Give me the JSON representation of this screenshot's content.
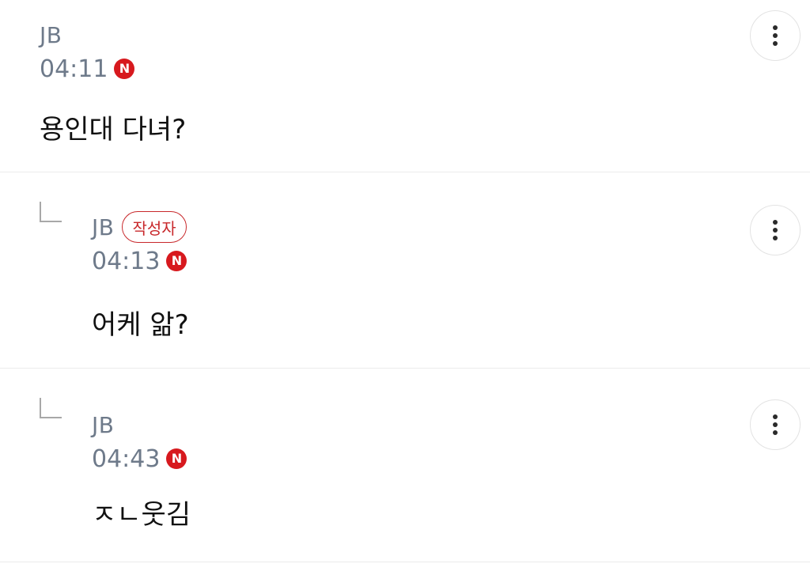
{
  "comments": [
    {
      "author": "JB",
      "time": "04:11",
      "new_badge": "N",
      "text": "용인대 다녀?",
      "is_reply": false,
      "writer_badge": null
    },
    {
      "author": "JB",
      "time": "04:13",
      "new_badge": "N",
      "text": "어케 앎?",
      "is_reply": true,
      "writer_badge": "작성자"
    },
    {
      "author": "JB",
      "time": "04:43",
      "new_badge": "N",
      "text": "ㅈㄴ웃김",
      "is_reply": true,
      "writer_badge": null
    }
  ],
  "colors": {
    "accent_red": "#d7191e",
    "meta_gray": "#6e7a8a",
    "divider": "#ebebeb"
  },
  "icons": {
    "more": "more-vertical-icon",
    "reply": "reply-arrow-icon",
    "new": "new-badge-icon"
  }
}
